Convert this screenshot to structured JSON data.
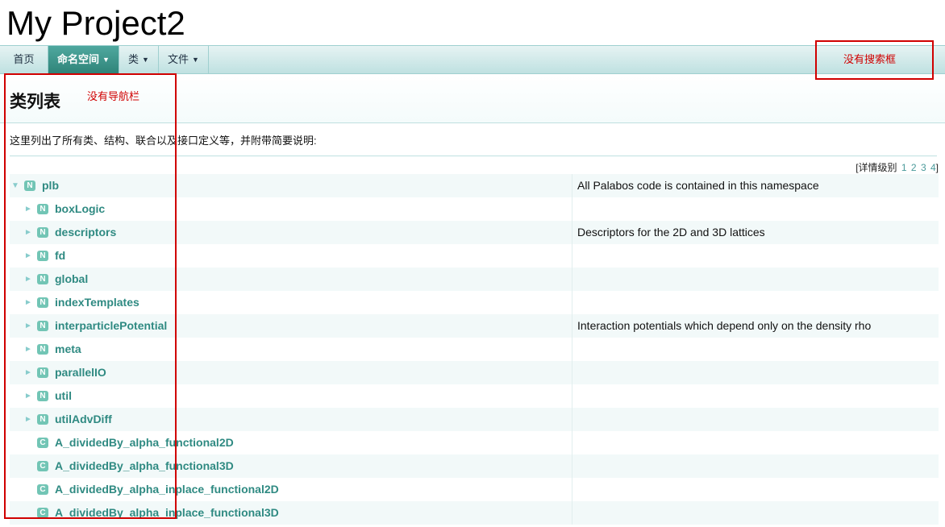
{
  "app": {
    "project_title": "My Project2"
  },
  "nav": {
    "items": [
      {
        "label": "首页",
        "caret": ""
      },
      {
        "label": "命名空间",
        "caret": "▼"
      },
      {
        "label": "类",
        "caret": "▼"
      },
      {
        "label": "文件",
        "caret": "▼"
      }
    ]
  },
  "page": {
    "title": "类列表",
    "description": "这里列出了所有类、结构、联合以及接口定义等，并附带简要说明:",
    "levels": {
      "prefix": "[详情级别",
      "values": [
        "1",
        "2",
        "3",
        "4"
      ],
      "suffix": "]"
    }
  },
  "annotations": {
    "search": "没有搜索框",
    "nav": "没有导航栏"
  },
  "tree": {
    "rows": [
      {
        "arrow": "▼",
        "badge": "N",
        "name": "plb",
        "desc": "All Palabos code is contained in this namespace"
      },
      {
        "arrow": "►",
        "badge": "N",
        "name": "boxLogic",
        "desc": ""
      },
      {
        "arrow": "►",
        "badge": "N",
        "name": "descriptors",
        "desc": "Descriptors for the 2D and 3D lattices"
      },
      {
        "arrow": "►",
        "badge": "N",
        "name": "fd",
        "desc": ""
      },
      {
        "arrow": "►",
        "badge": "N",
        "name": "global",
        "desc": ""
      },
      {
        "arrow": "►",
        "badge": "N",
        "name": "indexTemplates",
        "desc": ""
      },
      {
        "arrow": "►",
        "badge": "N",
        "name": "interparticlePotential",
        "desc": "Interaction potentials which depend only on the density rho"
      },
      {
        "arrow": "►",
        "badge": "N",
        "name": "meta",
        "desc": ""
      },
      {
        "arrow": "►",
        "badge": "N",
        "name": "parallelIO",
        "desc": ""
      },
      {
        "arrow": "►",
        "badge": "N",
        "name": "util",
        "desc": ""
      },
      {
        "arrow": "►",
        "badge": "N",
        "name": "utilAdvDiff",
        "desc": ""
      },
      {
        "arrow": "",
        "badge": "C",
        "name": "A_dividedBy_alpha_functional2D",
        "desc": ""
      },
      {
        "arrow": "",
        "badge": "C",
        "name": "A_dividedBy_alpha_functional3D",
        "desc": ""
      },
      {
        "arrow": "",
        "badge": "C",
        "name": "A_dividedBy_alpha_inplace_functional2D",
        "desc": ""
      },
      {
        "arrow": "",
        "badge": "C",
        "name": "A_dividedBy_alpha_inplace_functional3D",
        "desc": ""
      }
    ]
  },
  "colors": {
    "accent": "#2f8a82",
    "annotation": "#d00000",
    "badge": "#72c5b5"
  }
}
